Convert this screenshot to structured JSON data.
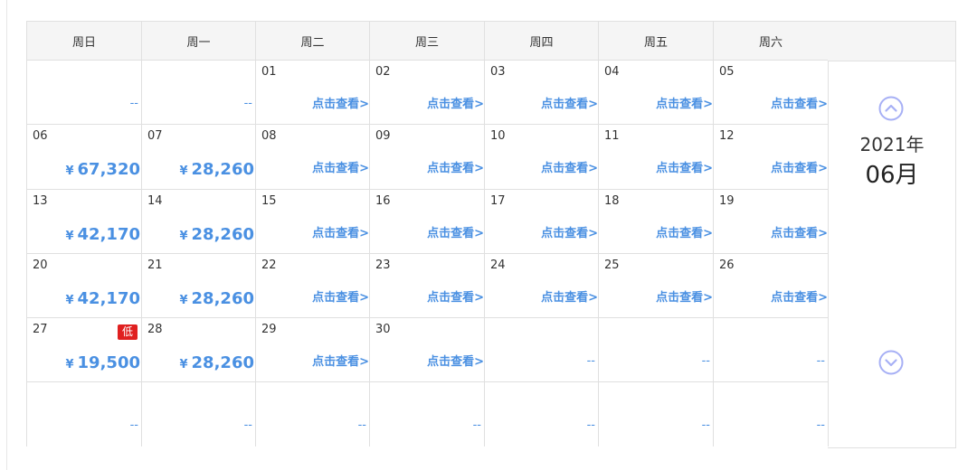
{
  "weekdays": [
    "周日",
    "周一",
    "周二",
    "周三",
    "周四",
    "周五",
    "周六"
  ],
  "nav": {
    "year": "2021年",
    "month": "06月",
    "prev_icon": "chevron-up-circle-icon",
    "next_icon": "chevron-down-circle-icon"
  },
  "labels": {
    "view": "点击查看>",
    "dash": "--",
    "low": "低",
    "currency": "¥"
  },
  "weeks": [
    [
      {
        "kind": "empty"
      },
      {
        "kind": "empty"
      },
      {
        "day": "01",
        "kind": "view"
      },
      {
        "day": "02",
        "kind": "view"
      },
      {
        "day": "03",
        "kind": "view"
      },
      {
        "day": "04",
        "kind": "view"
      },
      {
        "day": "05",
        "kind": "view"
      }
    ],
    [
      {
        "day": "06",
        "kind": "price",
        "price": "67,320"
      },
      {
        "day": "07",
        "kind": "price",
        "price": "28,260"
      },
      {
        "day": "08",
        "kind": "view"
      },
      {
        "day": "09",
        "kind": "view"
      },
      {
        "day": "10",
        "kind": "view"
      },
      {
        "day": "11",
        "kind": "view"
      },
      {
        "day": "12",
        "kind": "view"
      }
    ],
    [
      {
        "day": "13",
        "kind": "price",
        "price": "42,170"
      },
      {
        "day": "14",
        "kind": "price",
        "price": "28,260"
      },
      {
        "day": "15",
        "kind": "view"
      },
      {
        "day": "16",
        "kind": "view"
      },
      {
        "day": "17",
        "kind": "view"
      },
      {
        "day": "18",
        "kind": "view"
      },
      {
        "day": "19",
        "kind": "view"
      }
    ],
    [
      {
        "day": "20",
        "kind": "price",
        "price": "42,170"
      },
      {
        "day": "21",
        "kind": "price",
        "price": "28,260"
      },
      {
        "day": "22",
        "kind": "view"
      },
      {
        "day": "23",
        "kind": "view"
      },
      {
        "day": "24",
        "kind": "view"
      },
      {
        "day": "25",
        "kind": "view"
      },
      {
        "day": "26",
        "kind": "view"
      }
    ],
    [
      {
        "day": "27",
        "kind": "price",
        "price": "19,500",
        "low": true
      },
      {
        "day": "28",
        "kind": "price",
        "price": "28,260"
      },
      {
        "day": "29",
        "kind": "view"
      },
      {
        "day": "30",
        "kind": "view"
      },
      {
        "kind": "empty"
      },
      {
        "kind": "empty"
      },
      {
        "kind": "empty"
      }
    ],
    [
      {
        "kind": "empty"
      },
      {
        "kind": "empty"
      },
      {
        "kind": "empty"
      },
      {
        "kind": "empty"
      },
      {
        "kind": "empty"
      },
      {
        "kind": "empty"
      },
      {
        "kind": "empty"
      }
    ]
  ],
  "colors": {
    "accent": "#4a90e2",
    "low_badge": "#e02020",
    "header_bg": "#f5f5f5",
    "border": "#e0e0e0",
    "nav_icon": "#a7b0f5"
  }
}
